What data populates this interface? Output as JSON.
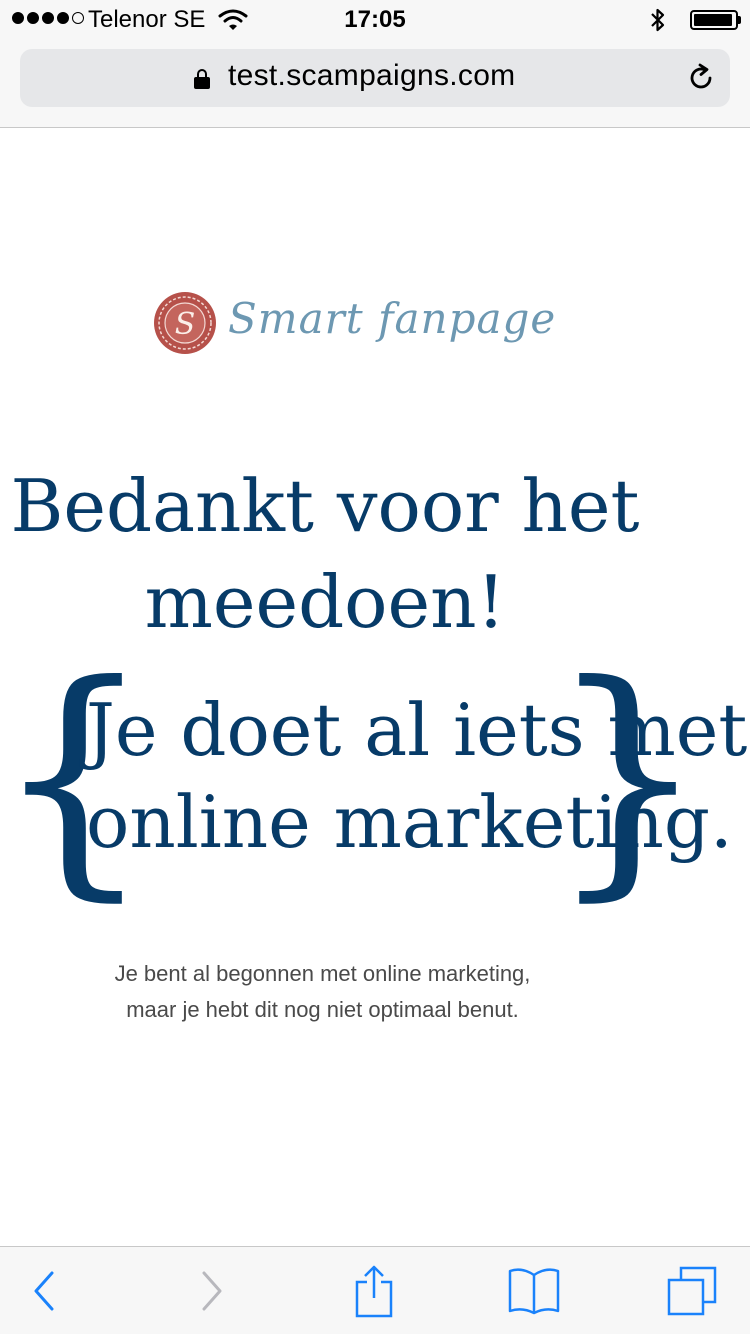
{
  "status_bar": {
    "carrier": "Telenor SE",
    "time": "17:05",
    "signal_bars": 4,
    "signal_total": 5
  },
  "browser": {
    "url": "test.scampaigns.com"
  },
  "logo": {
    "text": "Smart fanpage",
    "seal_letter": "S",
    "colors": {
      "seal": "#b6514a",
      "text": "#6d98b2"
    }
  },
  "content": {
    "heading": "Bedankt voor het\nmeedoen!",
    "sub_heading": "Je doet al iets met\nonline marketing.",
    "body": "Je bent al begonnen met online marketing,\nmaar je hebt dit nog niet optimaal benut.",
    "colors": {
      "heading": "#073b68",
      "body": "#4a4a4a"
    }
  },
  "toolbar": {
    "icons": [
      "back-icon",
      "forward-icon",
      "share-icon",
      "bookmarks-icon",
      "tabs-icon"
    ],
    "accent": "#1a82fb"
  }
}
